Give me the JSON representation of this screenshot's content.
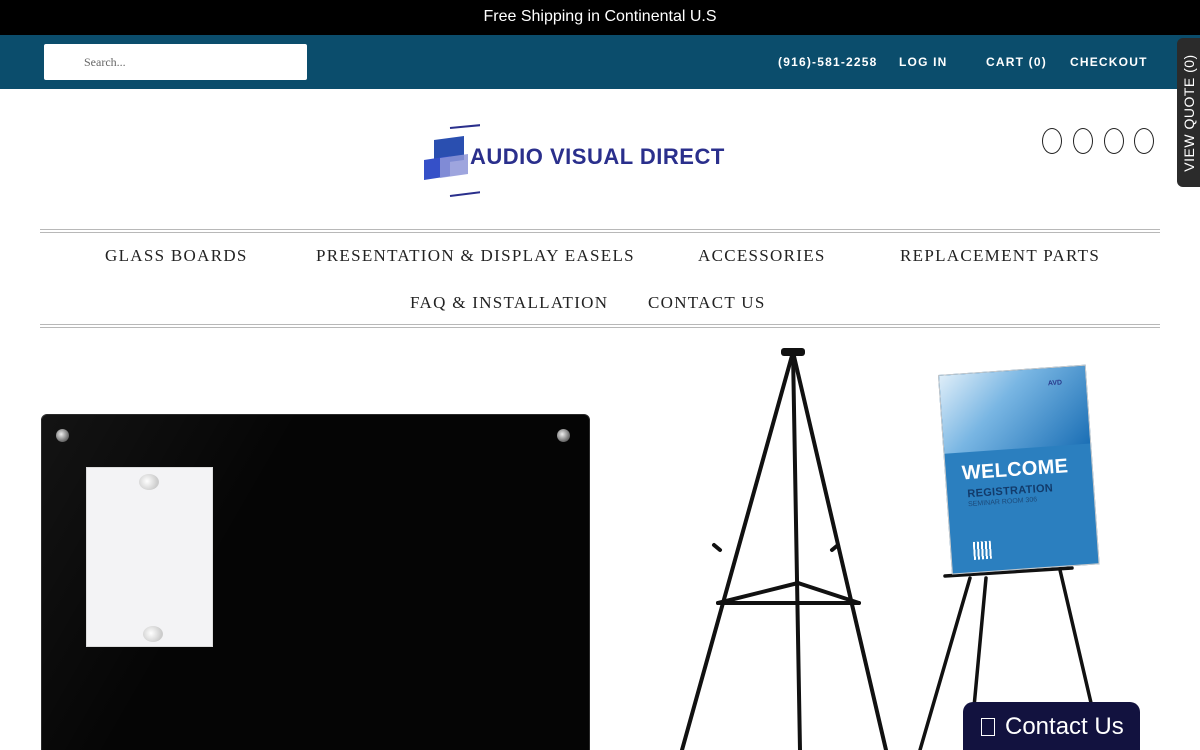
{
  "announcement": "Free Shipping in Continental U.S",
  "topbar": {
    "search_placeholder": "Search...",
    "phone": "(916)-581-2258",
    "login": "LOG IN",
    "cart": "CART (0)",
    "checkout": "CHECKOUT"
  },
  "view_quote": "VIEW QUOTE (0)",
  "logo": {
    "text": "AUDIO VISUAL DIRECT"
  },
  "social_icons": [
    "facebook-icon",
    "twitter-icon",
    "instagram-icon",
    "youtube-icon"
  ],
  "nav": {
    "row1": [
      "GLASS BOARDS",
      "PRESENTATION & DISPLAY EASELS",
      "ACCESSORIES",
      "REPLACEMENT PARTS"
    ],
    "row2": [
      "FAQ & INSTALLATION",
      "CONTACT US"
    ]
  },
  "sign": {
    "welcome": "WELCOME",
    "registration": "REGISTRATION",
    "room": "SEMINAR ROOM 306",
    "brand": "AVD"
  },
  "contact_widget": "Contact Us",
  "colors": {
    "topbar": "#0b4d6c",
    "logo": "#2a2f8c",
    "contact_widget": "#12123f"
  }
}
